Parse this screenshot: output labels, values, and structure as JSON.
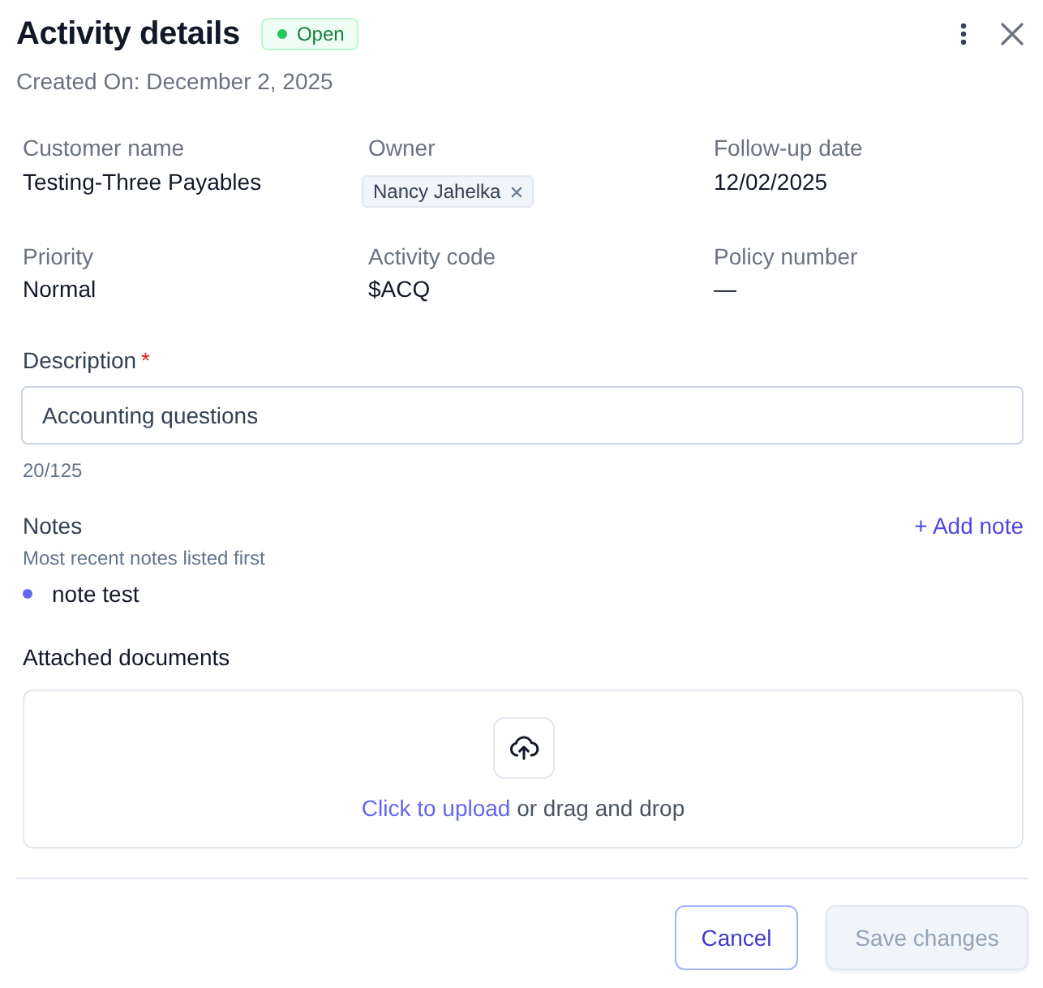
{
  "header": {
    "title": "Activity details",
    "status": {
      "label": "Open"
    },
    "created": "Created On: December 2, 2025"
  },
  "fields": [
    {
      "label": "Customer name",
      "kind": "text",
      "value": "Testing-Three Payables"
    },
    {
      "label": "Owner",
      "kind": "chip",
      "value": "Nancy Jahelka"
    },
    {
      "label": "Follow-up date",
      "kind": "text",
      "value": "12/02/2025"
    },
    {
      "label": "Priority",
      "kind": "text",
      "value": "Normal"
    },
    {
      "label": "Activity code",
      "kind": "text",
      "value": "$ACQ"
    },
    {
      "label": "Policy number",
      "kind": "text",
      "value": "—"
    }
  ],
  "description": {
    "label": "Description",
    "required_mark": "*",
    "value": "Accounting questions",
    "counter": "20/125"
  },
  "notes": {
    "title": "Notes",
    "add_label": "+ Add note",
    "hint": "Most recent notes listed first",
    "items": [
      {
        "text": "note test"
      }
    ]
  },
  "attachments": {
    "title": "Attached documents",
    "upload_link": "Click to upload",
    "upload_hint": "or drag and drop"
  },
  "footer": {
    "buttons": [
      {
        "label": "Cancel",
        "kind": "secondary",
        "disabled": false
      },
      {
        "label": "Save changes",
        "kind": "primary",
        "disabled": true
      }
    ]
  }
}
